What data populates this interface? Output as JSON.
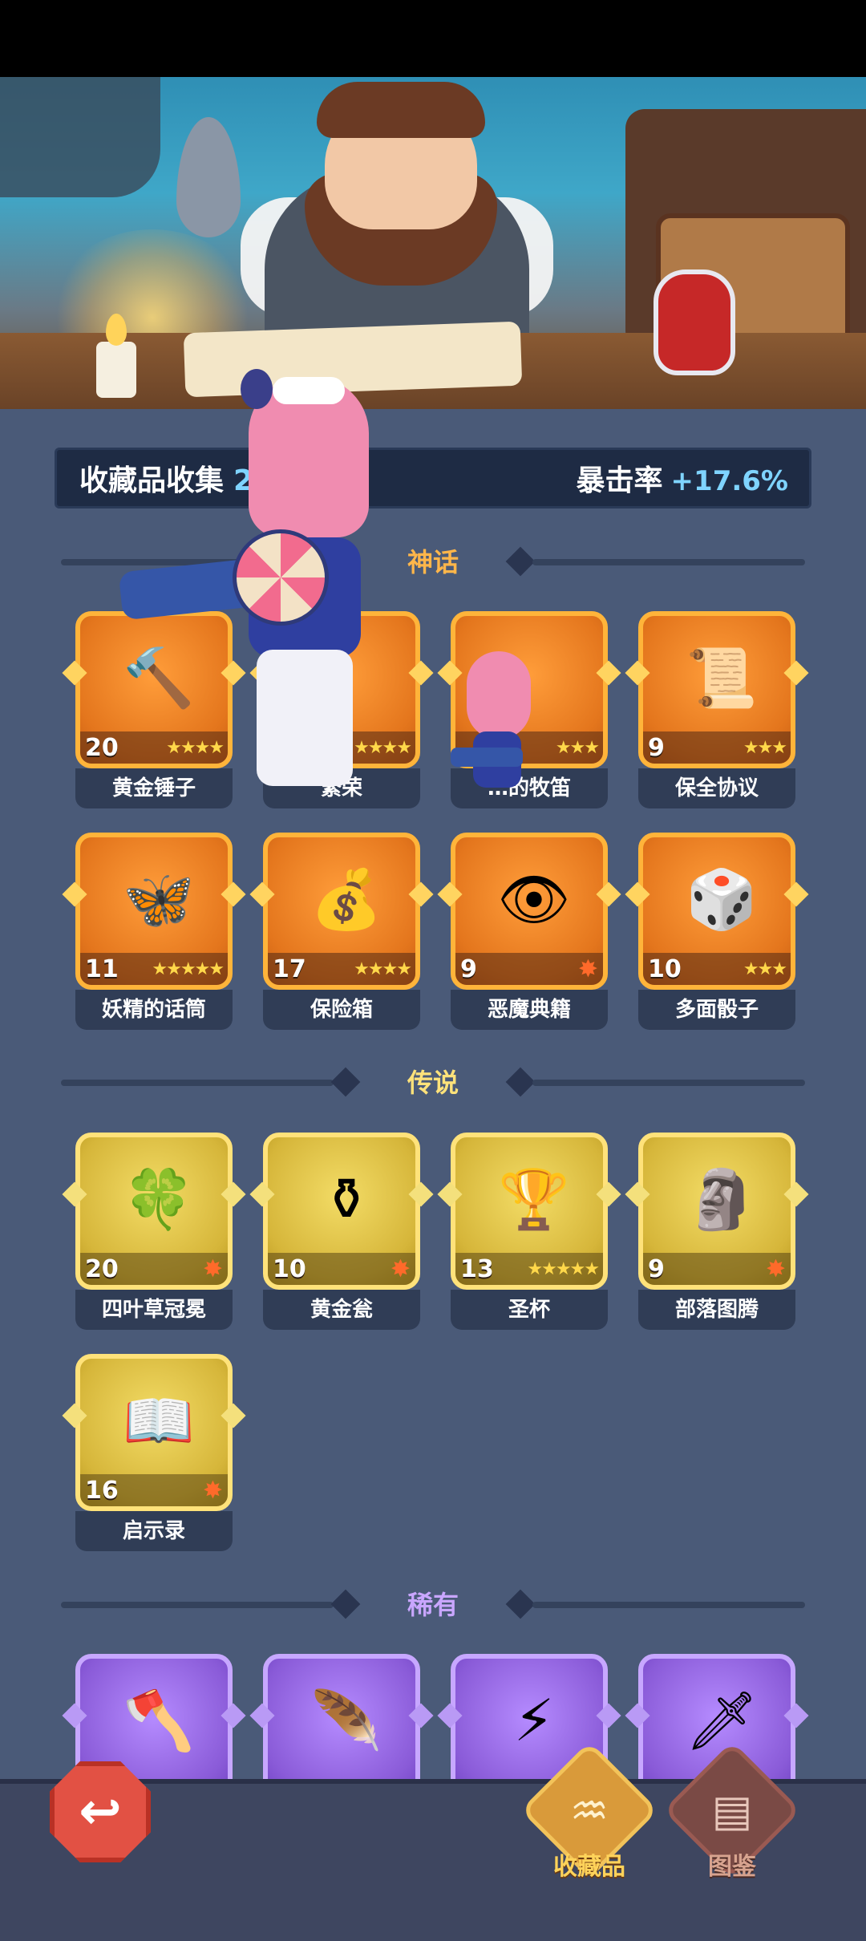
{
  "header": {
    "collection_label": "收藏品收集",
    "collection_count": "23/23",
    "crit_label": "暴击率",
    "crit_value": "+17.6%"
  },
  "sections": [
    {
      "title": "神话",
      "color": "#ffb64a"
    },
    {
      "title": "传说",
      "color": "#ffe27a"
    },
    {
      "title": "稀有",
      "color": "#c9a6ff"
    }
  ],
  "mythic_items": [
    {
      "name": "黄金锤子",
      "level": "20",
      "icon": "hammer-icon",
      "glyph": "🔨",
      "stars": "★★★★"
    },
    {
      "name": "繁荣",
      "level": "",
      "icon": "prosperity-icon",
      "glyph": "",
      "stars": "★★★★"
    },
    {
      "name": "…的牧笛",
      "level": "",
      "icon": "flute-icon",
      "glyph": "",
      "stars": "★★★"
    },
    {
      "name": "保全协议",
      "level": "9",
      "icon": "scroll-icon",
      "glyph": "📜",
      "stars": "★★★"
    },
    {
      "name": "妖精的话筒",
      "level": "11",
      "icon": "fairy-mic-icon",
      "glyph": "🦋",
      "stars": "★★★★★"
    },
    {
      "name": "保险箱",
      "level": "17",
      "icon": "treasure-chest-icon",
      "glyph": "💰",
      "stars": "★★★★"
    },
    {
      "name": "恶魔典籍",
      "level": "9",
      "icon": "demon-book-icon",
      "glyph": "👁",
      "stars": "✸"
    },
    {
      "name": "多面骰子",
      "level": "10",
      "icon": "d20-dice-icon",
      "glyph": "🎲",
      "stars": "★★★"
    }
  ],
  "legend_items": [
    {
      "name": "四叶草冠冕",
      "level": "20",
      "icon": "clover-crown-icon",
      "glyph": "🍀",
      "stars": "✸"
    },
    {
      "name": "黄金瓮",
      "level": "10",
      "icon": "golden-urn-icon",
      "glyph": "⚱",
      "stars": "✸"
    },
    {
      "name": "圣杯",
      "level": "13",
      "icon": "grail-icon",
      "glyph": "🏆",
      "stars": "★★★★★"
    },
    {
      "name": "部落图腾",
      "level": "9",
      "icon": "totem-icon",
      "glyph": "🗿",
      "stars": "✸"
    },
    {
      "name": "启示录",
      "level": "16",
      "icon": "open-book-icon",
      "glyph": "📖",
      "stars": "✸"
    }
  ],
  "rare_items": [
    {
      "icon": "axe-icon",
      "glyph": "🪓"
    },
    {
      "icon": "phoenix-feather-icon",
      "glyph": "🪶"
    },
    {
      "icon": "lightning-card-icon",
      "glyph": "⚡"
    },
    {
      "icon": "ice-dagger-icon",
      "glyph": "🗡"
    }
  ],
  "nav": {
    "back_glyph": "↩",
    "tab_collection_label": "收藏品",
    "tab_codex_label": "图鉴"
  }
}
